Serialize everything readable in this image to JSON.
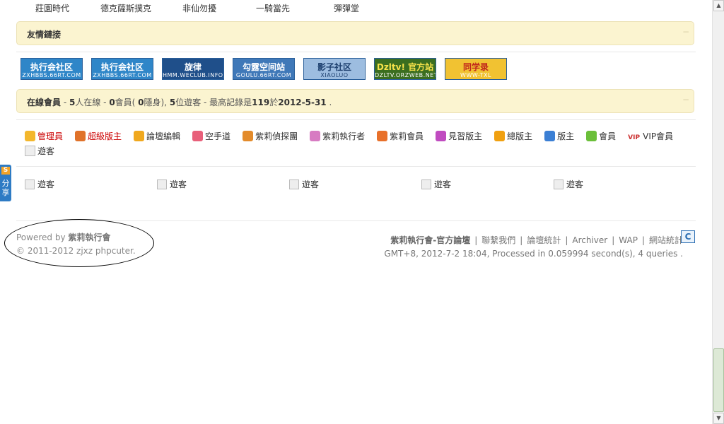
{
  "forum_links": [
    "莊園時代",
    "德克薩斯撲克",
    "非仙勿擾",
    "一騎當先",
    "彈彈堂"
  ],
  "friendly_links": {
    "title": "友情鏈接",
    "toggle": "−",
    "banners": [
      {
        "main": "执行会社区",
        "sub": "ZXHBBS.66RT.COM",
        "bg": "#2f86c8"
      },
      {
        "main": "执行会社区",
        "sub": "ZXHBBS.66RT.COM",
        "bg": "#2f86c8"
      },
      {
        "main": "旋律",
        "sub": "HMM.WECLUB.INFO/",
        "bg": "#1f4f8a"
      },
      {
        "main": "勾露空间站",
        "sub": "GOULU.66RT.COM",
        "bg": "#3f78b8"
      },
      {
        "main": "影子社区",
        "sub": "XIAOLUO",
        "bg": "#9dbde0"
      },
      {
        "main": "Dzltv! 官方站",
        "sub": "DZLTV.ORZWEB.NET",
        "bg": "#3b6e1f"
      },
      {
        "main": "同学录",
        "sub": "WWW-TXL",
        "bg": "#f1c232"
      }
    ]
  },
  "online": {
    "title": "在線會員",
    "summary_parts": [
      " - ",
      "5",
      "人在線 - ",
      "0",
      "會員( ",
      "0",
      "隱身), ",
      "5",
      "位遊客 - 最高記錄是",
      "119",
      "於",
      "2012-5-31",
      " ."
    ],
    "toggle": "−"
  },
  "legend": [
    {
      "label": "管理員",
      "icon": "admin-icon",
      "color": "#f3b72d",
      "red": true
    },
    {
      "label": "超級版主",
      "icon": "super-moderator-icon",
      "color": "#e0722a",
      "red": true
    },
    {
      "label": "論壇編輯",
      "icon": "editor-icon",
      "color": "#f0a81e",
      "red": false
    },
    {
      "label": "空手道",
      "icon": "karate-icon",
      "color": "#e8607a",
      "red": false
    },
    {
      "label": "紫莉偵探團",
      "icon": "detective-icon",
      "color": "#e38b2b",
      "red": false
    },
    {
      "label": "紫莉執行者",
      "icon": "executor-icon",
      "color": "#d77bc2",
      "red": false
    },
    {
      "label": "紫莉會員",
      "icon": "member-icon",
      "color": "#e8702a",
      "red": false
    },
    {
      "label": "見習版主",
      "icon": "trainee-moderator-icon",
      "color": "#c04bc0",
      "red": false
    },
    {
      "label": "總版主",
      "icon": "general-moderator-icon",
      "color": "#f0a010",
      "red": false
    },
    {
      "label": "版主",
      "icon": "moderator-icon",
      "color": "#3b7fd4",
      "red": false
    },
    {
      "label": "會員",
      "icon": "user-icon",
      "color": "#6bbf3a",
      "red": false
    },
    {
      "label": "VIP會員",
      "icon": "vip-icon",
      "color": "#ffffff",
      "red": false
    },
    {
      "label": "遊客",
      "icon": "guest-avatar-icon",
      "color": "#eeeeee",
      "red": false
    }
  ],
  "guests": [
    "遊客",
    "遊客",
    "遊客",
    "遊客",
    "遊客"
  ],
  "footer": {
    "powered_prefix": "Powered by ",
    "powered_name": "紫莉執行會",
    "copyright": "© 2011-2012 zjxz phpcuter.",
    "site_name": "紫莉執行會-官方論壇",
    "links": [
      "聯繫我們",
      "論壇統計",
      "Archiver",
      "WAP",
      "網站統計"
    ],
    "server_info": "GMT+8, 2012-7-2 18:04, Processed in 0.059994 second(s), 4 queries ."
  },
  "share_tab": {
    "logo": "S",
    "label": "分享"
  },
  "cnzz_badge": "C"
}
